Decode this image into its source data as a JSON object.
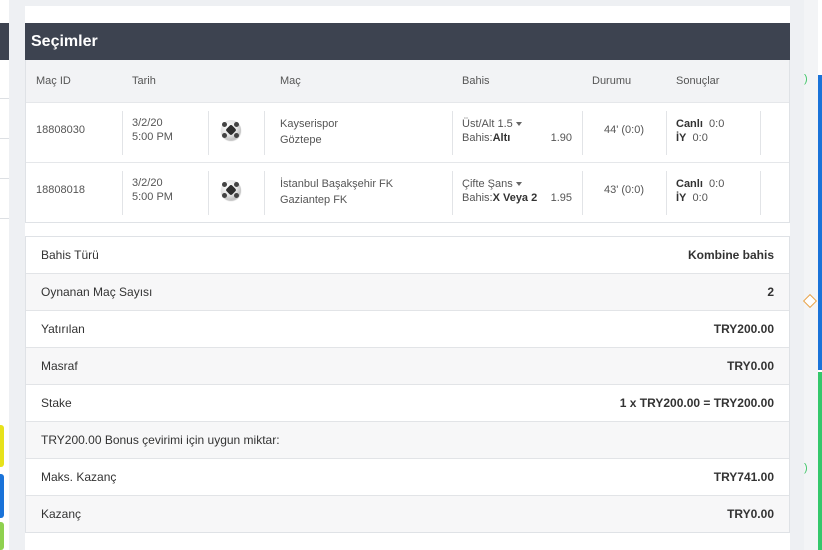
{
  "header": {
    "title": "Seçimler"
  },
  "columns": [
    "Maç ID",
    "Tarih",
    "Maç",
    "Bahis",
    "Durumu",
    "Sonuçlar"
  ],
  "selections": [
    {
      "id": "18808030",
      "date": "3/2/20",
      "time": "5:00 PM",
      "home": "Kayserispor",
      "away": "Göztepe",
      "market": "Üst/Alt 1.5",
      "bet_prefix": "Bahis:",
      "bet_value": "Altı",
      "odds": "1.90",
      "status": "44' (0:0)",
      "live_label": "Canlı",
      "live_score": "0:0",
      "ht_label": "İY",
      "ht_score": "0:0"
    },
    {
      "id": "18808018",
      "date": "3/2/20",
      "time": "5:00 PM",
      "home": "İstanbul Başakşehir FK",
      "away": "Gaziantep FK",
      "market": "Çifte Şans",
      "bet_prefix": "Bahis:",
      "bet_value": "X Veya 2",
      "odds": "1.95",
      "status": "43' (0:0)",
      "live_label": "Canlı",
      "live_score": "0:0",
      "ht_label": "İY",
      "ht_score": "0:0"
    }
  ],
  "summary": [
    {
      "label": "Bahis Türü",
      "value": "Kombine bahis"
    },
    {
      "label": "Oynanan Maç Sayısı",
      "value": "2"
    },
    {
      "label": "Yatırılan",
      "value": "TRY200.00"
    },
    {
      "label": "Masraf",
      "value": "TRY0.00"
    },
    {
      "label": "Stake",
      "value": "1 x TRY200.00 = TRY200.00"
    },
    {
      "label": "TRY200.00 Bonus çevirimi için uygun miktar:",
      "value": ""
    },
    {
      "label": "Maks. Kazanç",
      "value": "TRY741.00"
    },
    {
      "label": "Kazanç",
      "value": "TRY0.00"
    }
  ],
  "colors": {
    "header_bg": "#3d4350",
    "accent_blue": "#1a73d9",
    "accent_green": "#35c76b"
  }
}
